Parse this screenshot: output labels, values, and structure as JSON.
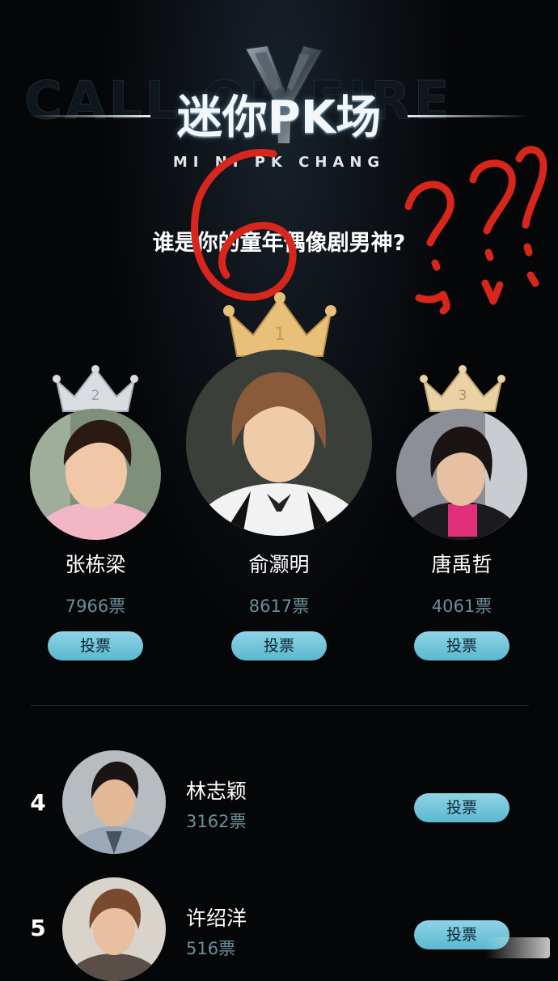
{
  "header": {
    "title": "迷你PK场",
    "subtitle": "MI NI PK CHANG",
    "background_word": "CALL OF FIRE",
    "question": "谁是你的童年偶像剧男神?"
  },
  "podium": [
    {
      "rank": "1",
      "name": "俞灏明",
      "votes": "8617票",
      "button": "投票",
      "crown_color": "#e8c07a"
    },
    {
      "rank": "2",
      "name": "张栋梁",
      "votes": "7966票",
      "button": "投票",
      "crown_color": "#d9dde2"
    },
    {
      "rank": "3",
      "name": "唐禹哲",
      "votes": "4061票",
      "button": "投票",
      "crown_color": "#ead2a4"
    }
  ],
  "list": [
    {
      "rank": "4",
      "name": "林志颖",
      "votes": "3162票",
      "button": "投票"
    },
    {
      "rank": "5",
      "name": "许绍洋",
      "votes": "516票",
      "button": "投票"
    }
  ],
  "colors": {
    "background": "#050608",
    "accent_button": "#6fc3d9",
    "vote_text": "#6b8f99",
    "annotation_red": "#d8261d"
  }
}
